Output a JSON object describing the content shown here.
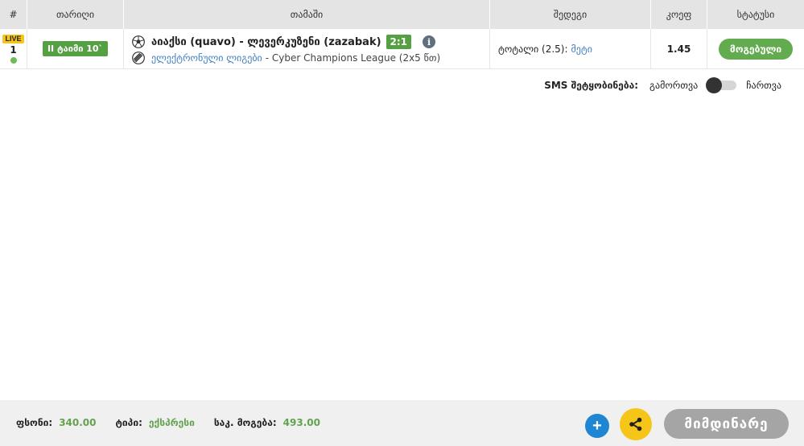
{
  "table": {
    "headers": [
      "#",
      "თარიღი",
      "თამაში",
      "შედეგი",
      "კოეფ",
      "სტატუსი"
    ],
    "row": {
      "live_label": "LIVE",
      "number": "1",
      "time_badge": "II ტაიმი 10`",
      "match_title": "აიაქსი (quavo) - ლევერკუზენი (zazabak)",
      "score": "2:1",
      "info_glyph": "i",
      "league_link": "ელექტრონული ლიგები",
      "league_rest": "- Cyber Champions League (2x5 წთ)",
      "result_label": "ტოტალი (2.5):",
      "result_value": "მეტი",
      "odds": "1.45",
      "status": "მოგებული"
    }
  },
  "sms": {
    "label": "SMS შეტყობინება:",
    "off_label": "გამორთვა",
    "on_label": "ჩართვა",
    "enabled": false
  },
  "footer": {
    "stake_label": "ფსონი:",
    "stake_value": "340.00",
    "type_label": "ტიპი:",
    "type_value": "ექსპრესი",
    "win_label": "საკ. მოგება:",
    "win_value": "493.00",
    "add_glyph": "+",
    "current_label": "მიმდინარე"
  },
  "icons": {
    "sport": "soccer-ball-icon",
    "league": "esports-league-icon",
    "info": "info-icon",
    "share": "share-icon",
    "add": "plus-icon"
  },
  "colors": {
    "header_bg": "#e4e4e4",
    "green": "#63ab4f",
    "link_blue": "#3f7fbf",
    "live_yellow": "#f5c518",
    "add_blue": "#1e86d2",
    "current_gray": "#a5a5a5"
  }
}
